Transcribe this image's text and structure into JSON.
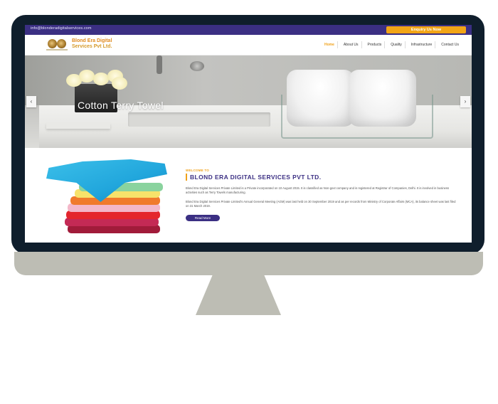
{
  "topbar": {
    "email": "info@blonderadigitalservices.com",
    "enquiry_label": "Enquiry Us Now"
  },
  "header": {
    "brand_line1": "Blond Era Digital",
    "brand_line2": "Services Pvt Ltd.",
    "nav": [
      {
        "label": "Home",
        "active": true
      },
      {
        "label": "About Us",
        "active": false
      },
      {
        "label": "Products",
        "active": false
      },
      {
        "label": "Quality",
        "active": false
      },
      {
        "label": "Infrastructure",
        "active": false
      },
      {
        "label": "Contact Us",
        "active": false
      }
    ]
  },
  "hero": {
    "caption": "Cotton Terry Towel",
    "prev_icon": "chevron-left-icon",
    "next_icon": "chevron-right-icon"
  },
  "about": {
    "tag": "WELCOME TO",
    "title": "BLOND ERA DIGITAL SERVICES PVT LTD.",
    "paragraph1": "Blond Era Digital Services Private Limited is a Private incorporated on 10 August 2015. It is classified as Non-govt company and is registered at Registrar of Companies, Delhi. It is involved in business activities such as Terry Towels manufacturing.",
    "paragraph2": "Blond Era Digital Services Private Limited's Annual General Meeting (AGM) was last held on 30 September 2019 and as per records from Ministry of Corporate Affairs (MCA), its balance sheet was last filed on 31 March 2019.",
    "read_more_label": "Read More"
  },
  "colors": {
    "primary": "#3b2f83",
    "accent": "#f0a11a",
    "bezel": "#0f1e2c",
    "stand": "#bdbdb4"
  }
}
